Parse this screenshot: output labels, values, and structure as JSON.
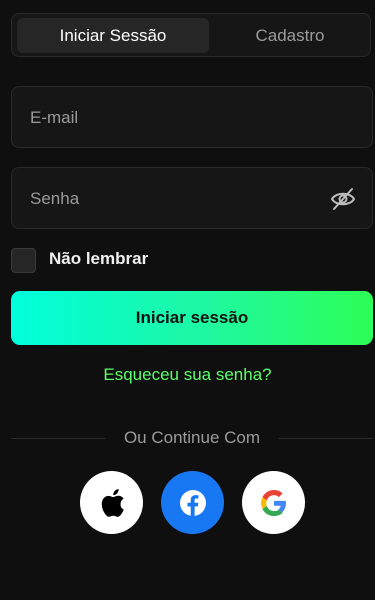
{
  "tabs": {
    "login": "Iniciar Sessão",
    "register": "Cadastro"
  },
  "form": {
    "email_placeholder": "E-mail",
    "password_placeholder": "Senha",
    "remember_label": "Não lembrar",
    "submit_label": "Iniciar sessão",
    "forgot_link": "Esqueceu sua senha?"
  },
  "social": {
    "divider_text": "Ou Continue Com",
    "providers": [
      "apple-icon",
      "facebook-icon",
      "google-icon"
    ]
  },
  "colors": {
    "background": "#0f0f10",
    "accent_gradient_start": "#00ffdd",
    "accent_gradient_end": "#2cff55",
    "link": "#5cff6b",
    "facebook": "#1877f2"
  }
}
